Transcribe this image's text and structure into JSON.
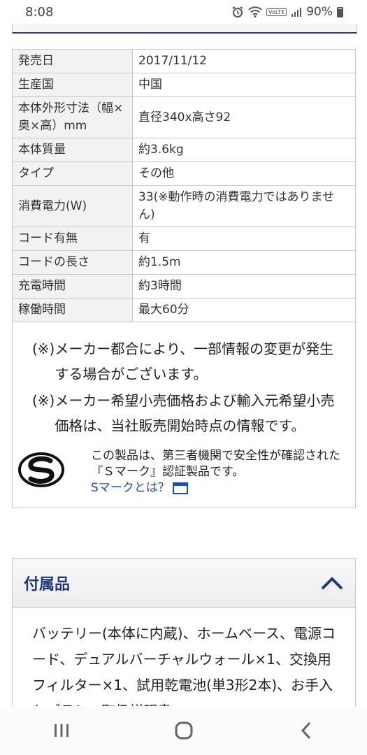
{
  "status_bar": {
    "time": "8:08",
    "battery": "90%",
    "volte_label": "VoLTE"
  },
  "specs": [
    {
      "label": "発売日",
      "value": "2017/11/12"
    },
    {
      "label": "生産国",
      "value": "中国"
    },
    {
      "label": "本体外形寸法（幅×奥×高）mm",
      "value": "直径340x高さ92"
    },
    {
      "label": "本体質量",
      "value": "約3.6kg"
    },
    {
      "label": "タイプ",
      "value": "その他"
    },
    {
      "label": "消費電力(W)",
      "value": "33(※動作時の消費電力ではありません)"
    },
    {
      "label": "コード有無",
      "value": "有"
    },
    {
      "label": "コードの長さ",
      "value": "約1.5m"
    },
    {
      "label": "充電時間",
      "value": "約3時間"
    },
    {
      "label": "稼働時間",
      "value": "最大60分"
    }
  ],
  "notes": [
    {
      "mark": "(※)",
      "text": "メーカー都合により、一部情報の変更が発生する場合がございます。"
    },
    {
      "mark": "(※)",
      "text": "メーカー希望小売価格および輸入元希望小売価格は、当社販売開始時点の情報です。"
    }
  ],
  "smark": {
    "text": "この製品は、第三者機関で安全性が確認された『Ｓマーク』認証製品です。",
    "link": "Sマークとは？"
  },
  "accessories": {
    "title": "付属品",
    "body": "バッテリー(本体に内蔵)、ホームベース、電源コード、デュアルバーチャルウォール×1、交換用フィルター×1、試用乾電池(単3形2本)、お手入れブラシ、取扱説明書"
  }
}
